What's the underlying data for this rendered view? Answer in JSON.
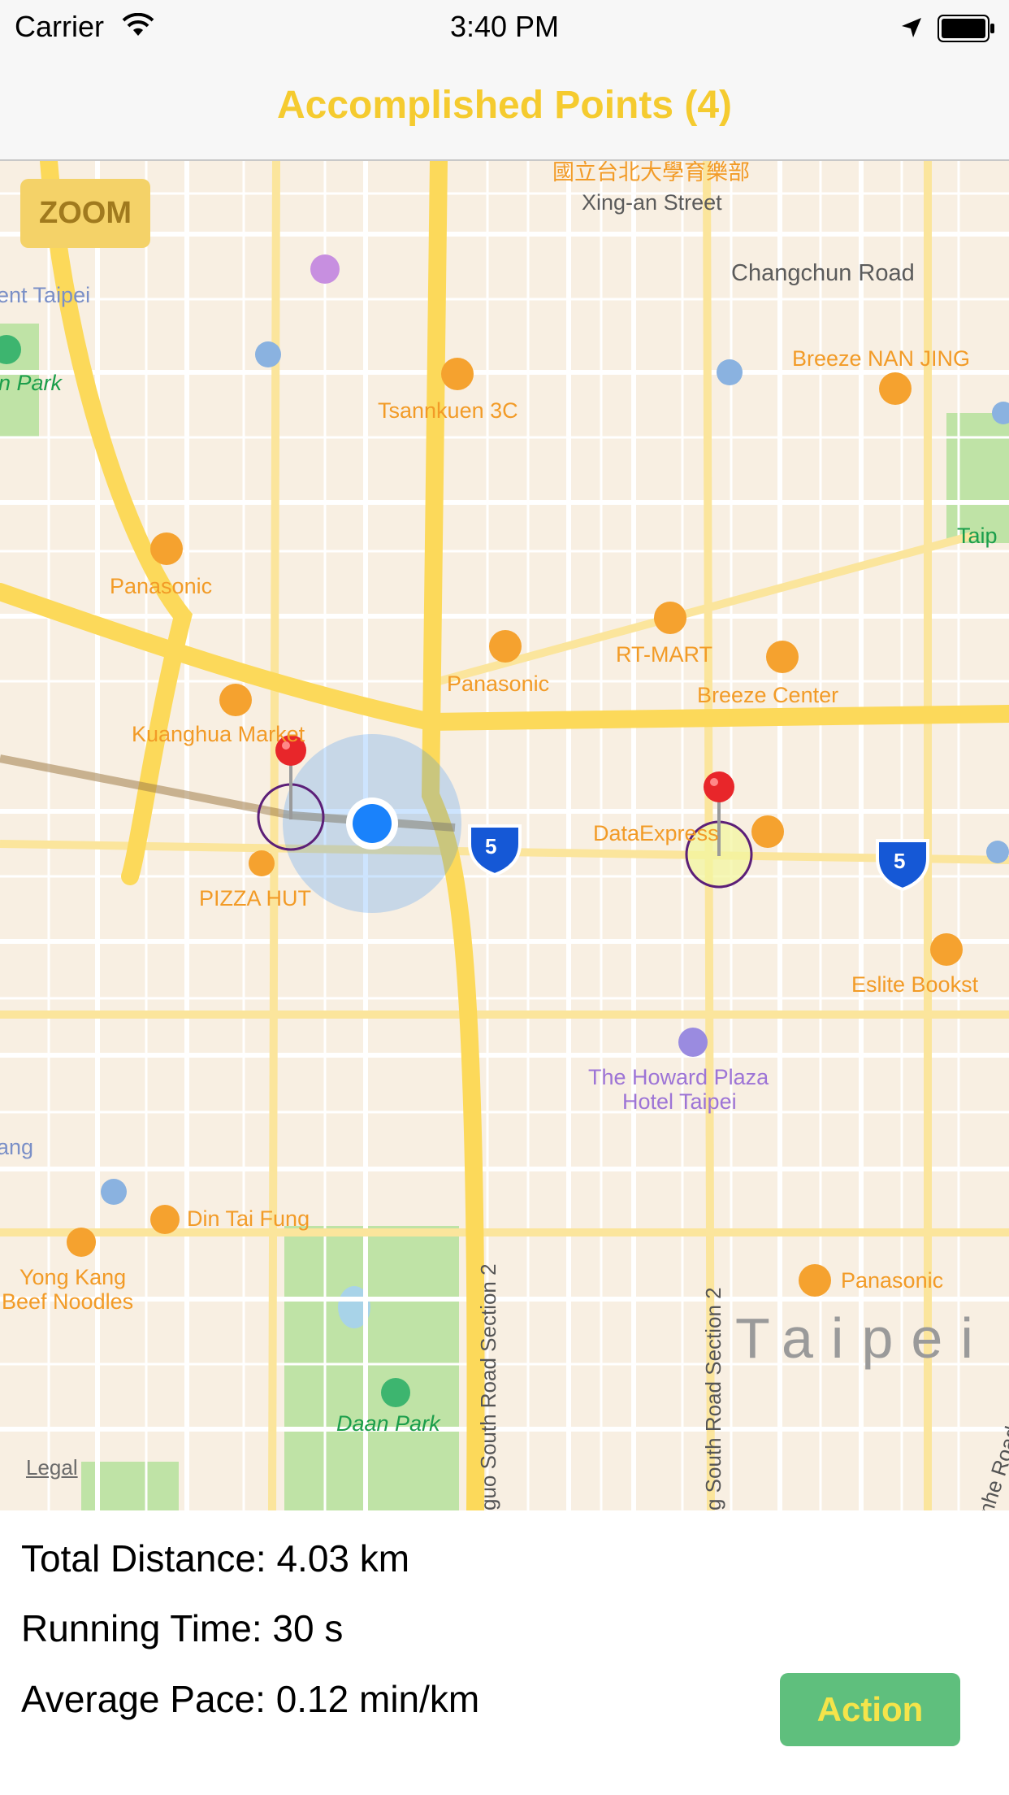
{
  "status_bar": {
    "carrier": "Carrier",
    "time": "3:40 PM",
    "wifi_icon": "wifi-icon",
    "location_icon": "location-arrow-icon",
    "battery_icon": "battery-icon"
  },
  "nav": {
    "title": "Accomplished Points (4)",
    "title_color": "#f5cb2f"
  },
  "map": {
    "zoom_label": "ZOOM",
    "legal": "Legal",
    "city": "Taipei",
    "labels": {
      "top_chinese": "國立台北大學育樂部",
      "xing_an": "Xing-an Street",
      "changchun": "Changchun Road",
      "ent_taipei": "ent Taipei",
      "n_park": "n Park",
      "breeze_nanjing": "Breeze NAN JING",
      "tsannkuen": "Tsannkuen 3C",
      "taip": "Taip",
      "panasonic1": "Panasonic",
      "panasonic2": "Panasonic",
      "rt_mart": "RT-MART",
      "breeze_center": "Breeze Center",
      "kuanghua": "Kuanghua Market",
      "dataexpress": "DataExpress",
      "pizza_hut": "PIZZA HUT",
      "eslite": "Eslite Bookst",
      "howard1": "The Howard Plaza",
      "howard2": "Hotel Taipei",
      "ang": "ang",
      "din_tai_fung": "Din Tai Fung",
      "yong_kang1": "Yong Kang",
      "yong_kang2": "Beef Noodles",
      "panasonic3": "Panasonic",
      "daan_park": "Daan Park",
      "road1": "guo South Road Section 2",
      "road2": "g South Road Section 2",
      "road3": "nhe Road"
    },
    "highway_shield": "5",
    "colors": {
      "background": "#f8efe2",
      "major_road": "#fcd95a",
      "user_location": "#1a82fb",
      "pin": "#e8262a"
    }
  },
  "stats": {
    "distance": "Total Distance: 4.03 km",
    "time": "Running Time: 30 s",
    "pace": "Average Pace: 0.12 min/km"
  },
  "action": {
    "label": "Action",
    "color": "#5fbf7d"
  }
}
